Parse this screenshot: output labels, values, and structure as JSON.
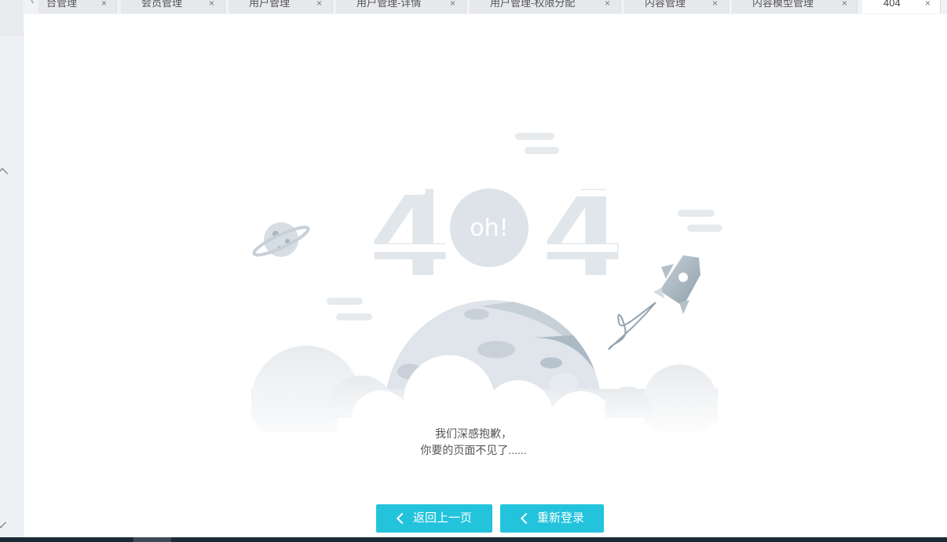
{
  "tabs": [
    {
      "label": "台管理",
      "close": "×"
    },
    {
      "label": "会员管理",
      "close": "×"
    },
    {
      "label": "用户管理",
      "close": "×"
    },
    {
      "label": "用户管理-详情",
      "close": "×"
    },
    {
      "label": "用户管理-权限分配",
      "close": "×"
    },
    {
      "label": "内容管理",
      "close": "×"
    },
    {
      "label": "内容模型管理",
      "close": "×"
    },
    {
      "label": "404",
      "close": "×",
      "active": true
    }
  ],
  "illustration": {
    "big_text": "404",
    "bubble_text": "oh!"
  },
  "message": {
    "line1": "我们深感抱歉，",
    "line2": "你要的页面不见了......"
  },
  "buttons": {
    "back_label": "返回上一页",
    "relogin_label": "重新登录"
  },
  "colors": {
    "accent": "#23c3dc",
    "moon_light": "#dfe5ea",
    "moon_dark": "#a9b8c4",
    "text": "#555555"
  }
}
